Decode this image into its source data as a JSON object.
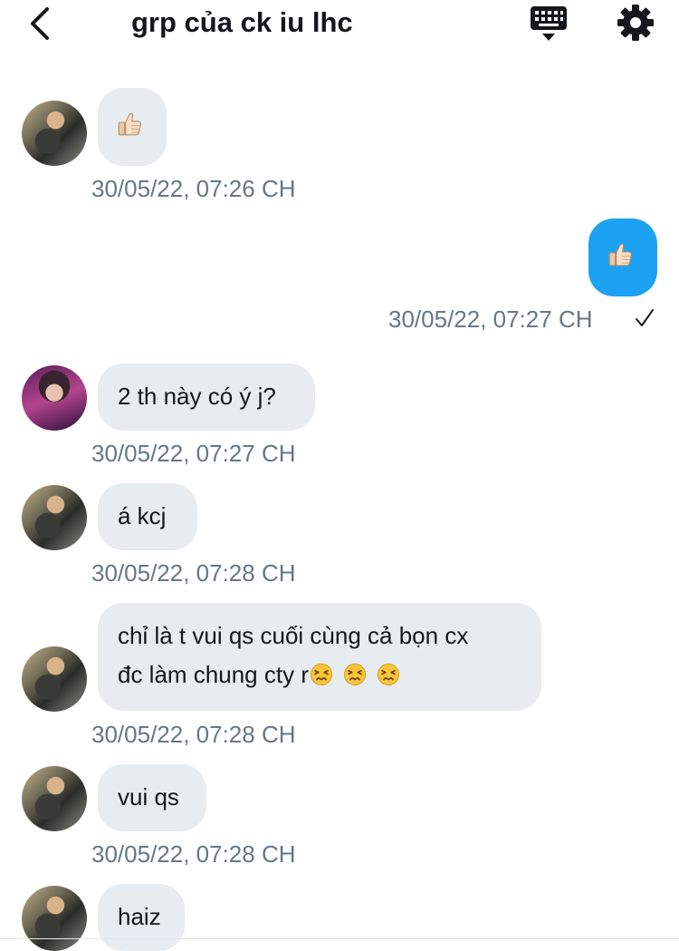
{
  "header": {
    "title": "grp của ck iu lhc",
    "back_icon": "back-arrow-icon",
    "keyboard_icon": "keyboard-icon",
    "settings_icon": "gear-icon"
  },
  "messages": [
    {
      "sender": "other",
      "avatar": "avatar-a",
      "emoji": "thumbs-up-light-skin",
      "timestamp": "30/05/22, 07:26 CH"
    },
    {
      "sender": "me",
      "emoji": "thumbs-up-light-skin",
      "timestamp": "30/05/22, 07:27 CH",
      "status_icon": "checkmark-icon"
    },
    {
      "sender": "other",
      "avatar": "avatar-b",
      "text": "2 th này có ý j?",
      "timestamp": "30/05/22, 07:27 CH"
    },
    {
      "sender": "other",
      "avatar": "avatar-a",
      "text": "á kcj",
      "timestamp": "30/05/22, 07:28 CH"
    },
    {
      "sender": "other",
      "avatar": "avatar-a",
      "text_line1": "chỉ là t vui qs cuối cùng cả bọn cx",
      "text_line2": "đc làm chung cty r",
      "emoji": "persevering-face",
      "timestamp": "30/05/22, 07:28 CH"
    },
    {
      "sender": "other",
      "avatar": "avatar-a",
      "text": "vui qs",
      "timestamp": "30/05/22, 07:28 CH"
    },
    {
      "sender": "other",
      "avatar": "avatar-a",
      "text": "haiz"
    }
  ],
  "colors": {
    "incoming_bubble": "#e6ecf0",
    "outgoing_bubble": "#1da1f2",
    "timestamp": "#657786",
    "text": "#14171a"
  }
}
